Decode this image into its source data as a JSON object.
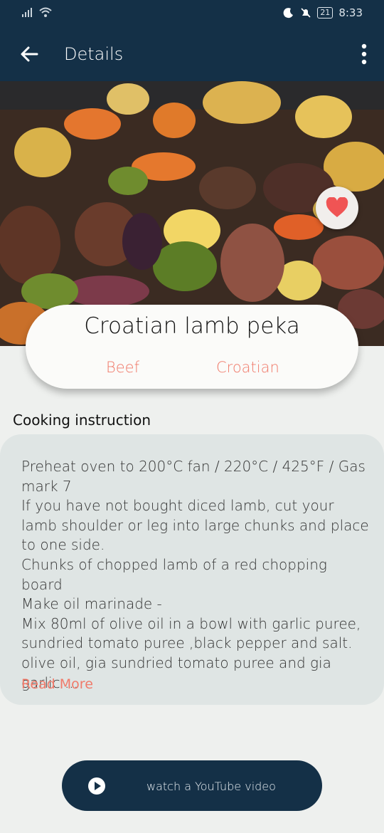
{
  "status_bar": {
    "time": "8:33",
    "battery": "21",
    "icons": [
      "signal-icon",
      "wifi-icon",
      "moon-icon",
      "mute-icon",
      "battery-icon"
    ]
  },
  "app_bar": {
    "title": "Details",
    "icons": [
      "back-arrow-icon",
      "more-vert-icon"
    ]
  },
  "recipe": {
    "name": "Croatian lamb peka",
    "category": "Beef",
    "area": "Croatian",
    "favorite_icon": "heart-icon",
    "favorite_color": "#f05454"
  },
  "instructions": {
    "heading": "Cooking instruction",
    "text": "Preheat oven to 200°C fan / 220°C / 425°F / Gas mark 7\nIf you have not bought diced lamb, cut your lamb shoulder or leg into large chunks and place to one side.\nChunks of chopped lamb of a red chopping board\nMake oil marinade -\nMix 80ml of olive oil in a bowl with garlic puree, sundried tomato puree ,black pepper and salt.\nolive oil, gia sundried tomato puree and gia garlic ...",
    "read_more": "Read More"
  },
  "youtube": {
    "label": "watch a YouTube video",
    "icon": "play-icon"
  },
  "colors": {
    "primary": "#143047",
    "accent": "#f07a6a",
    "background": "#eef0ee"
  }
}
